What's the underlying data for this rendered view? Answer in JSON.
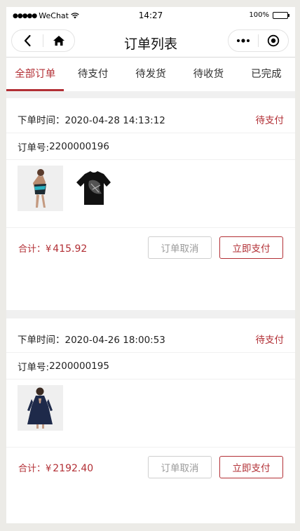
{
  "status_bar": {
    "carrier": "WeChat",
    "time": "14:27",
    "battery": "100%"
  },
  "navbar": {
    "title": "订单列表"
  },
  "tabs": [
    {
      "label": "全部订单",
      "active": true
    },
    {
      "label": "待支付",
      "active": false
    },
    {
      "label": "待发货",
      "active": false
    },
    {
      "label": "待收货",
      "active": false
    },
    {
      "label": "已完成",
      "active": false
    }
  ],
  "labels": {
    "time_prefix": "下单时间：",
    "order_prefix": "订单号:",
    "total_prefix": "合计：",
    "currency": "¥",
    "cancel_button": "订单取消",
    "pay_button": "立即支付"
  },
  "orders": [
    {
      "time": "2020-04-28 14:13:12",
      "status": "待支付",
      "order_no": "2200000196",
      "total": "415.92",
      "images": [
        "dress-teal-thumbnail",
        "black-tshirt-thumbnail"
      ]
    },
    {
      "time": "2020-04-26 18:00:53",
      "status": "待支付",
      "order_no": "2200000195",
      "total": "2192.40",
      "images": [
        "navy-dress-thumbnail"
      ]
    }
  ],
  "colors": {
    "accent": "#b22f35",
    "background": "#ecebe7"
  }
}
